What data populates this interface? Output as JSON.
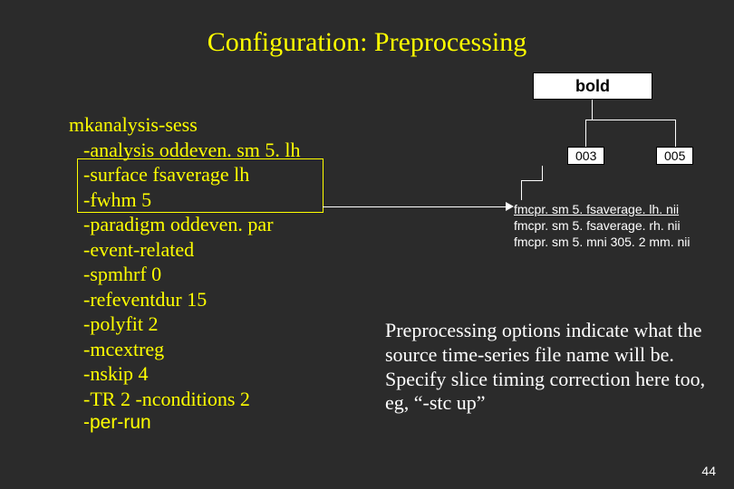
{
  "title": "Configuration: Preprocessing",
  "bold_label": "bold",
  "runs": {
    "r003": "003",
    "r005": "005"
  },
  "config": {
    "cmd": "mkanalysis-sess",
    "flags": [
      "-analysis oddeven. sm 5. lh",
      "-surface fsaverage lh",
      "-fwhm 5",
      "-paradigm oddeven. par",
      "-event-related",
      "-spmhrf 0",
      "-refeventdur 15",
      "-polyfit 2",
      "-mcextreg",
      "-nskip 4",
      "-TR 2 -nconditions 2"
    ],
    "per_run": "-per-run"
  },
  "files": {
    "lh": "fmcpr. sm 5. fsaverage. lh. nii",
    "rh": "fmcpr. sm 5. fsaverage. rh. nii",
    "mni": "fmcpr. sm 5. mni 305. 2 mm. nii"
  },
  "paragraph": "Preprocessing options indicate what the source time-series file name will be. Specify slice timing correction here too, eg, “-stc up”",
  "page": "44"
}
